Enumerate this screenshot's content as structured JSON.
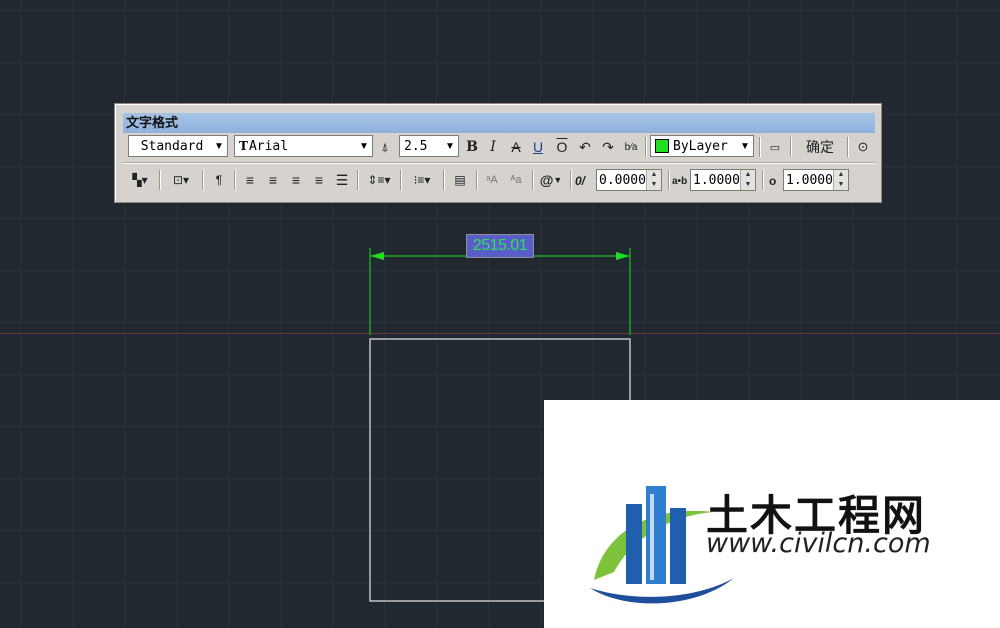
{
  "toolbar": {
    "title": "文字格式",
    "style": "Standard",
    "font": "Arial",
    "font_prefix": "T",
    "height": "2.5",
    "color": "ByLayer",
    "color_swatch": "#22dd22",
    "ok_label": "确定",
    "oblique": "0.0000",
    "tracking": "1.0000",
    "width_factor": "1.0000",
    "bold_label": "B",
    "italic_label": "I",
    "strike_label": "A",
    "underline_label": "U",
    "overline_label": "O",
    "at_label": "@",
    "oblique_prefix": "0/",
    "tracking_prefix": "a•b",
    "width_prefix": "o"
  },
  "dimension": {
    "value": "2515.01",
    "color": "#2fe05a"
  },
  "watermark": {
    "title": "土木工程网",
    "url": "www.civilcn.com"
  }
}
